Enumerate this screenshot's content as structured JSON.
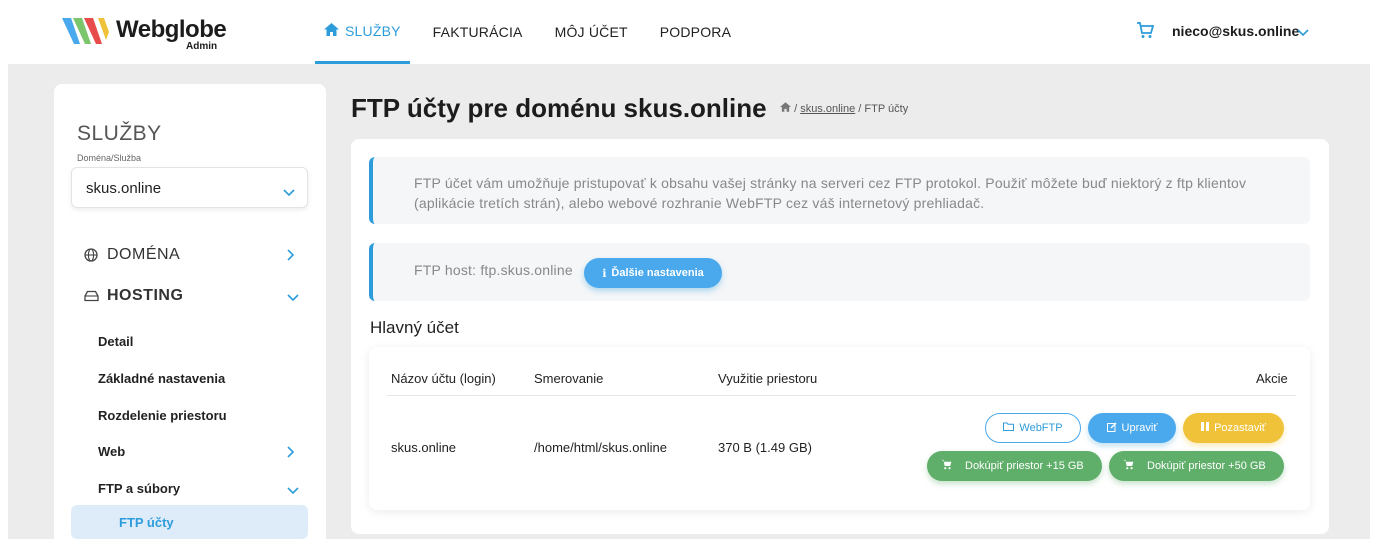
{
  "header": {
    "brand": "Webglobe",
    "brand_sub": "Admin",
    "nav": [
      {
        "label": "SLUŽBY",
        "active": true
      },
      {
        "label": "FAKTURÁCIA"
      },
      {
        "label": "MÔJ ÚČET"
      },
      {
        "label": "PODPORA"
      }
    ],
    "user": "nieco@skus.online",
    "accent": "#2d9cdb"
  },
  "sidebar": {
    "title": "SLUŽBY",
    "select_label": "Doména/Služba",
    "select_value": "skus.online",
    "sections": [
      {
        "label": "DOMÉNA",
        "icon": "globe-icon"
      },
      {
        "label": "HOSTING",
        "icon": "server-icon"
      }
    ],
    "sub_items": [
      "Detail",
      "Základné nastavenia",
      "Rozdelenie priestoru",
      "Web",
      "FTP a súbory"
    ],
    "active_item": "FTP účty"
  },
  "main": {
    "title": "FTP účty pre doménu skus.online",
    "breadcrumb_link": "skus.online",
    "breadcrumb_current": "FTP účty",
    "info_text": "FTP účet vám umožňuje pristupovať k obsahu vašej stránky na serveri cez FTP protokol. Použiť môžete buď niektorý z ftp klientov (aplikácie tretích strán), alebo webové rozhranie WebFTP cez váš internetový prehliadač.",
    "ftp_host": "FTP host: ftp.skus.online",
    "more_settings": "Ďalšie nastavenia",
    "section_title": "Hlavný účet",
    "table": {
      "headers": [
        "Názov účtu (login)",
        "Smerovanie",
        "Využitie priestoru",
        "Akcie"
      ],
      "row": {
        "login": "skus.online",
        "path": "/home/html/skus.online",
        "usage": "370 B (1.49 GB)"
      }
    },
    "actions": {
      "webftp": "WebFTP",
      "edit": "Upraviť",
      "pause": "Pozastaviť",
      "buy15": "Dokúpiť priestor +15 GB",
      "buy50": "Dokúpiť priestor +50 GB"
    }
  }
}
